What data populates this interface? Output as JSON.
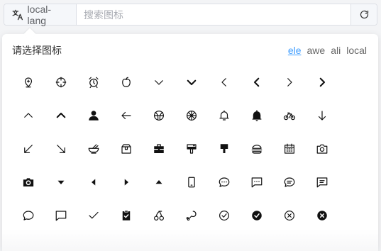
{
  "search": {
    "prefix_icon": "translate-icon",
    "prefix_label": "local-lang",
    "placeholder": "搜索图标",
    "value": "",
    "refresh_icon": "refresh-icon"
  },
  "popover": {
    "title": "请选择图标",
    "tabs": [
      {
        "label": "ele",
        "active": true
      },
      {
        "label": "awe",
        "active": false
      },
      {
        "label": "ali",
        "active": false
      },
      {
        "label": "local",
        "active": false
      }
    ],
    "icons": [
      "location-pin-icon",
      "aim-icon",
      "alarm-clock-icon",
      "apple-icon",
      "arrow-down-icon",
      "arrow-down-bold-icon",
      "arrow-left-icon",
      "arrow-left-bold-icon",
      "arrow-right-icon",
      "arrow-right-bold-icon",
      "arrow-up-icon",
      "arrow-up-bold-icon",
      "user-filled-icon",
      "back-icon",
      "basketball-icon",
      "baseball-icon",
      "bell-icon",
      "bell-filled-icon",
      "bicycle-icon",
      "bottom-icon",
      "bottom-left-icon",
      "bottom-right-icon",
      "bowl-icon",
      "box-icon",
      "briefcase-icon",
      "brush-filled-icon",
      "brush-icon",
      "burger-icon",
      "calendar-icon",
      "camera-icon",
      "camera-filled-icon",
      "caret-bottom-icon",
      "caret-left-icon",
      "caret-right-icon",
      "caret-top-icon",
      "cellphone-icon",
      "chat-dot-round-icon",
      "chat-dot-square-icon",
      "chat-line-round-icon",
      "chat-line-square-icon",
      "chat-round-icon",
      "chat-square-icon",
      "check-icon",
      "checked-icon",
      "cherry-icon",
      "chicken-icon",
      "circle-check-icon",
      "circle-check-filled-icon",
      "circle-close-icon",
      "circle-close-filled-icon"
    ]
  }
}
